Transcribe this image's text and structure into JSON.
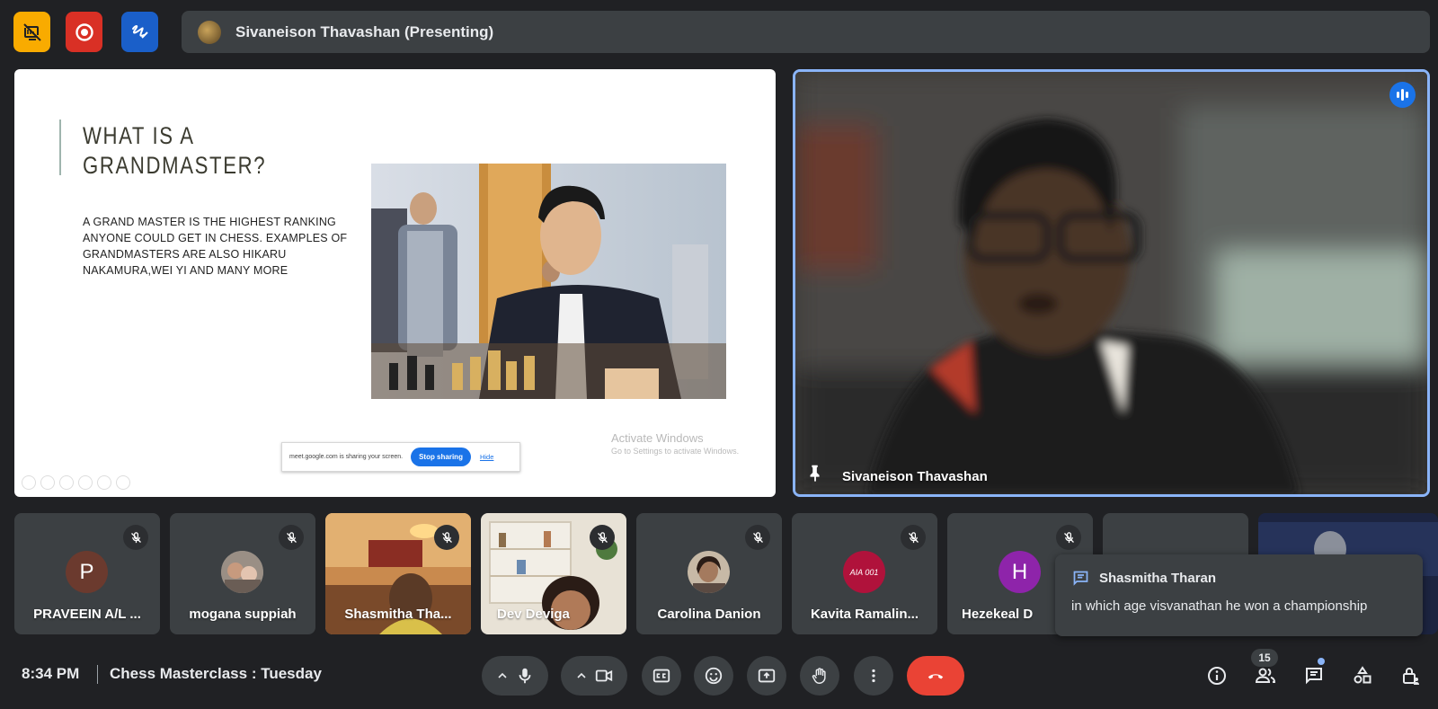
{
  "top_bar": {
    "presenting_label": "Sivaneison Thavashan (Presenting)",
    "colors": {
      "btn1": "#f9ab00",
      "btn2": "#d93025",
      "btn3": "#1a5fc9"
    },
    "icons": [
      "screen-off-icon",
      "record-icon",
      "whiteboard-icon"
    ]
  },
  "slide": {
    "title": "WHAT IS A GRANDMASTER?",
    "body": "A GRAND MASTER IS THE HIGHEST RANKING ANYONE COULD GET IN CHESS.  EXAMPLES OF GRANDMASTERS ARE ALSO HIKARU NAKAMURA,WEI YI AND MANY MORE",
    "share_text": "meet.google.com is sharing your screen.",
    "stop_sharing": "Stop sharing",
    "hide": "Hide",
    "activate_line1": "Activate Windows",
    "activate_line2": "Go to Settings to activate Windows."
  },
  "speaker": {
    "name": "Sivaneison Thavashan"
  },
  "tiles": [
    {
      "name": "PRAVEEIN A/L ...",
      "initial": "P",
      "avatar_color": "#6b3a2e"
    },
    {
      "name": "mogana suppiah",
      "initial": "",
      "avatar_color": "#8c8c8c"
    },
    {
      "name": "Shasmitha Tha...",
      "initial": "",
      "avatar_color": ""
    },
    {
      "name": "Dev Deviga",
      "initial": "",
      "avatar_color": ""
    },
    {
      "name": "Carolina Danion",
      "initial": "",
      "avatar_color": "#a58d78"
    },
    {
      "name": "Kavita Ramalin...",
      "initial": "AIA 001",
      "avatar_color": "#b0123b"
    },
    {
      "name": "Hezekeal D",
      "initial": "H",
      "avatar_color": "#8e24aa"
    }
  ],
  "toast": {
    "sender": "Shasmitha Tharan",
    "message": "in which age  visvanathan he won a championship"
  },
  "bottom_bar": {
    "time": "8:34 PM",
    "meeting_title": "Chess Masterclass : Tuesday",
    "participant_count": "15"
  }
}
